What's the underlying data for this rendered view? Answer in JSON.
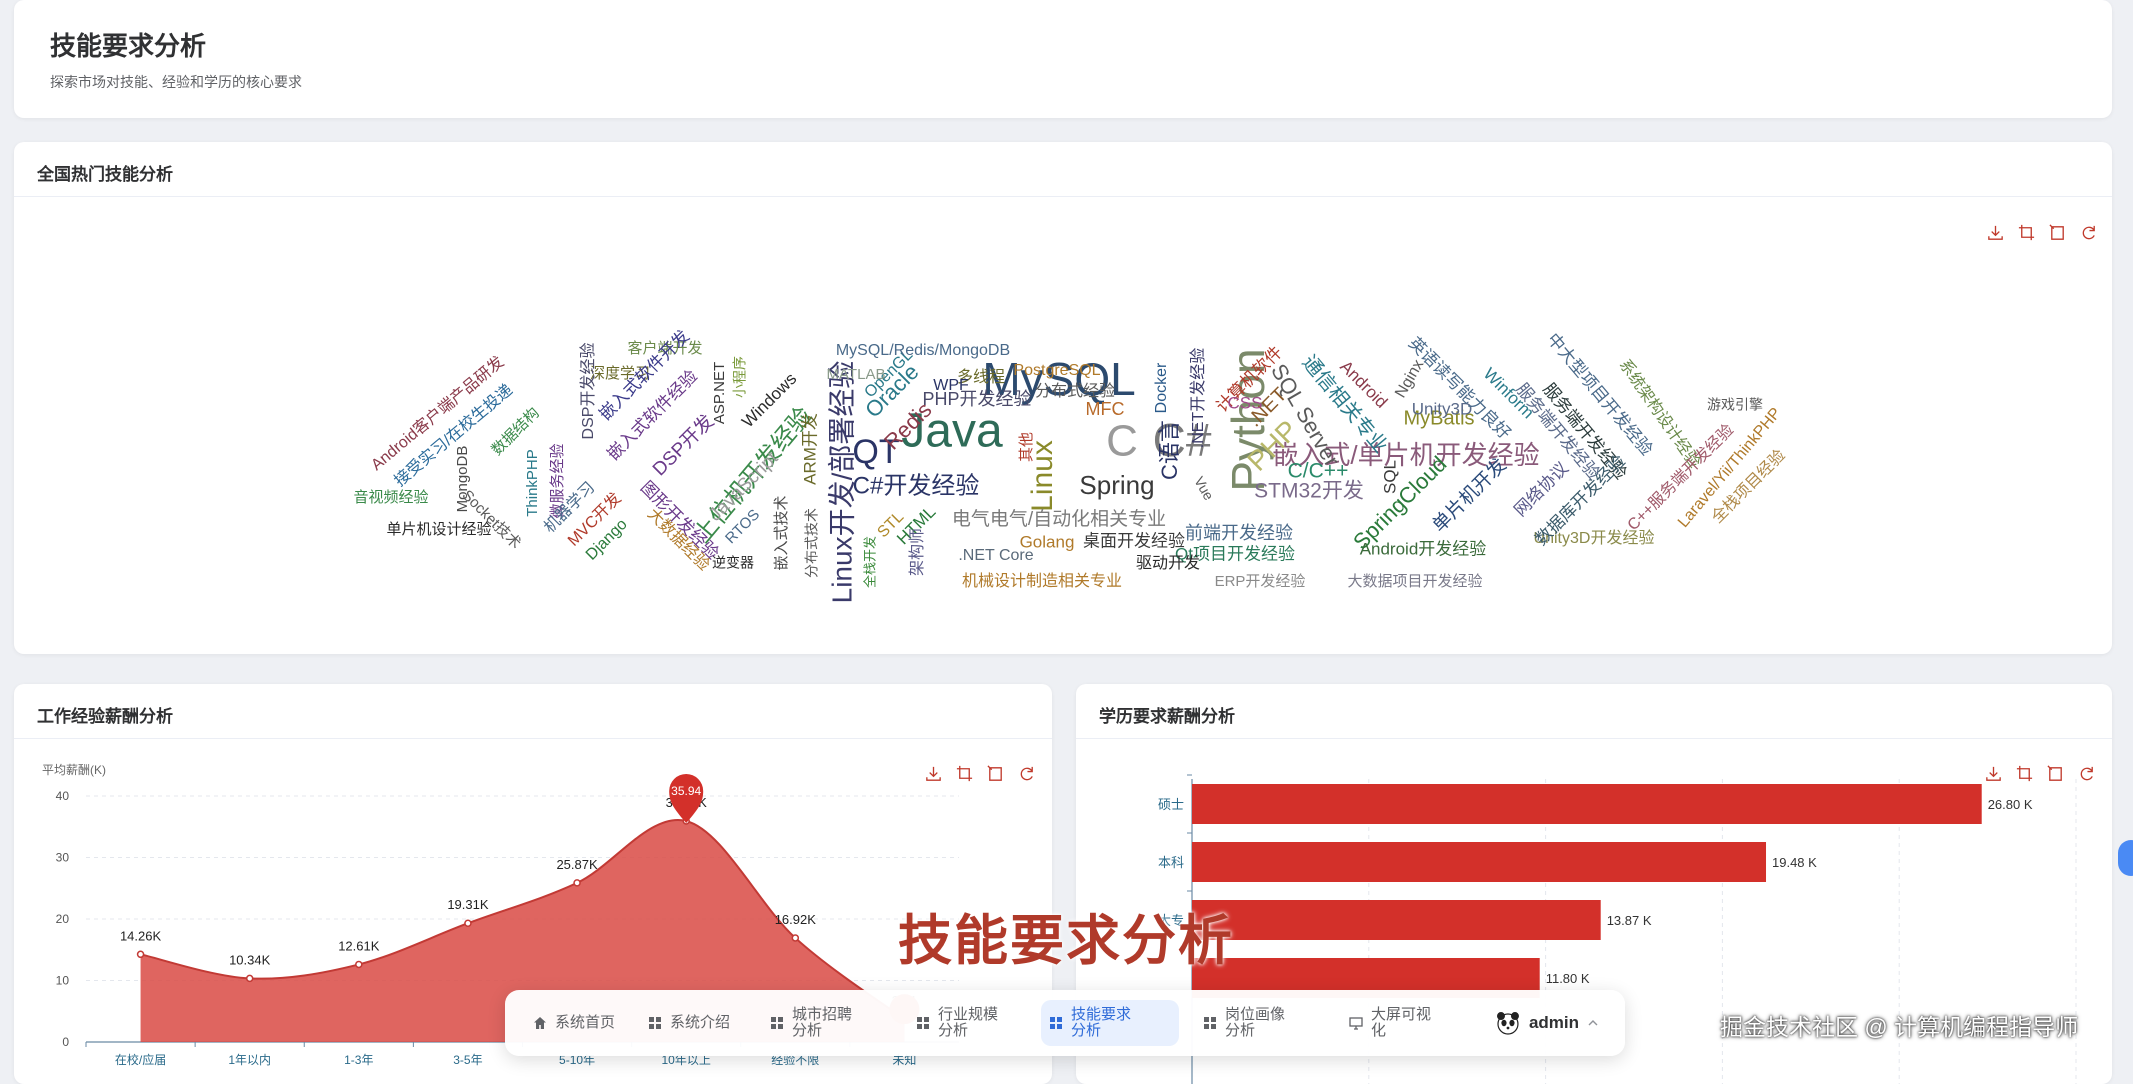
{
  "header": {
    "title": "技能要求分析",
    "subtitle": "探索市场对技能、经验和学历的核心要求"
  },
  "skills_card": {
    "title": "全国热门技能分析"
  },
  "experience_card": {
    "title": "工作经验薪酬分析",
    "y_axis_name": "平均薪酬(K)",
    "max_marker": "35.94"
  },
  "education_card": {
    "title": "学历要求薪酬分析"
  },
  "toolbox": {
    "icons": [
      "download-icon",
      "zoom-icon",
      "zoom-back-icon",
      "restore-icon"
    ]
  },
  "colors": {
    "primary_red": "#d3302a",
    "area_red": "#d94a44",
    "nav_active": "#2f6bd8"
  },
  "chart_data": [
    {
      "type": "wordcloud",
      "words": [
        "MySQL",
        "Java",
        "C",
        "C#",
        "Python",
        "Linux",
        "QT",
        "Spring",
        "C#开发经验",
        "Linux开发/部署经验",
        "嵌入式/单片机开发经验",
        "上位机开发经验",
        "PHP",
        "C语言",
        "Redis",
        "Oracle",
        "STM32开发",
        "C/C++",
        "SQL Server",
        ".NET",
        "MyBatis",
        "SpringCloud",
        "Android开发经验",
        "Unity3D开发经验",
        "前端开发经验",
        "Qt项目开发经验",
        "桌面开发经验",
        "电气电气/自动化相关专业",
        "机械设计制造相关专业",
        "ERP开发经验",
        "大数据项目开发经验",
        "PHP开发经验",
        "分布式经验",
        "PostgreSQL",
        "多线程",
        "MFC",
        "WPF",
        "OpenGL",
        "MATLAB",
        "MySQL/Redis/MongoDB",
        "客户端开发",
        "深度学习",
        "嵌入式软件开发",
        "嵌入式软件经验",
        "DSP开发经验",
        "DSP开发",
        "ASP.NET",
        "小程序",
        "Windows",
        "JavaScript",
        "ARM开发",
        "RTOS",
        "嵌入式技术",
        "分布式技术",
        "STL",
        "HTML",
        "架构师",
        "全栈开发",
        "Golang",
        ".NET Core",
        "驱动开发",
        "Vue",
        "Docker",
        ".NET开发经验",
        "计算机软件",
        "CSS",
        "Android",
        "通信相关专业",
        "Nginx",
        "Unity3D",
        "英语读写能力良好",
        "Winform",
        "中大型项目开发经验",
        "系统架构设计经验",
        "服务端开发经验",
        "服务端开发经验",
        "网络协议",
        "数据库开发经验",
        "C++服务端开发经验",
        "Laravel/Yii/ThinkPHP",
        "全栈项目经验",
        "游戏引擎",
        "单片机开发",
        "SQL",
        "Android客户端产品研发",
        "接受实习/在校生投递",
        "数据结构",
        "音视频经验",
        "MongoDB",
        "ThinkPHP",
        "微服务经验",
        "Socket技术",
        "机器学习",
        "MVC开发",
        "Django",
        "图形开发经验",
        "大数据经验",
        "逆变器",
        "单片机设计经验",
        "其他"
      ]
    },
    {
      "type": "area",
      "categories": [
        "在校/应届",
        "1年以内",
        "1-3年",
        "3-5年",
        "5-10年",
        "10年以上",
        "经验不限",
        "未知"
      ],
      "values": [
        14.26,
        10.34,
        12.61,
        19.31,
        25.87,
        35.94,
        16.92,
        3.71
      ],
      "value_labels": [
        "14.26K",
        "10.34K",
        "12.61K",
        "19.31K",
        "25.87K",
        "35.94K",
        "16.92K",
        "3.71"
      ],
      "ylabel": "平均薪酬(K)",
      "ylim": [
        0,
        40
      ],
      "yticks": [
        "0",
        "10",
        "20",
        "30",
        "40"
      ]
    },
    {
      "type": "bar",
      "orientation": "horizontal",
      "categories": [
        "硕士",
        "本科",
        "大专"
      ],
      "values": [
        26.8,
        19.48,
        13.87,
        11.8
      ],
      "value_labels": [
        "26.80 K",
        "19.48 K",
        "13.87 K",
        "11.80 K"
      ],
      "xlim": [
        0,
        30
      ]
    }
  ],
  "overlay_title": "技能要求分析",
  "dock": {
    "items": [
      {
        "label": "系统首页",
        "icon": "home-icon"
      },
      {
        "label": "系统介绍",
        "icon": "grid-icon"
      },
      {
        "label": "城市招聘分析",
        "icon": "grid-icon"
      },
      {
        "label": "行业规模分析",
        "icon": "grid-icon"
      },
      {
        "label": "技能要求分析",
        "icon": "grid-icon",
        "active": true
      },
      {
        "label": "岗位画像分析",
        "icon": "grid-icon"
      },
      {
        "label": "大屏可视化",
        "icon": "monitor-icon"
      }
    ],
    "user": "admin"
  },
  "watermark": "掘金技术社区 @ 计算机编程指导师"
}
